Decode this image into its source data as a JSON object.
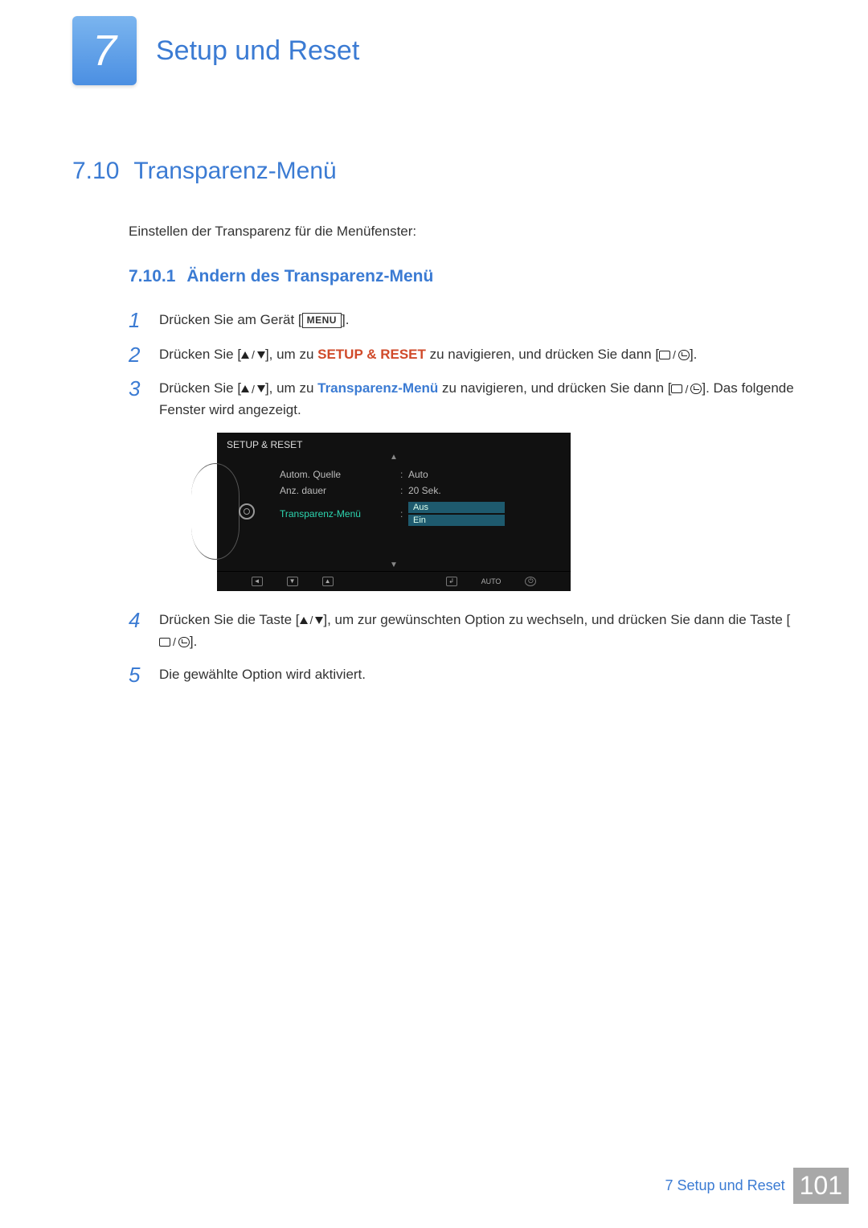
{
  "chapter": {
    "number": "7",
    "title": "Setup und Reset"
  },
  "section": {
    "number": "7.10",
    "title": "Transparenz-Menü"
  },
  "intro": "Einstellen der Transparenz für die Menüfenster:",
  "subsection": {
    "number": "7.10.1",
    "title": "Ändern des Transparenz-Menü"
  },
  "labels": {
    "menu": "MENU",
    "setup_reset": "SETUP & RESET",
    "transparenz": "Transparenz-Menü"
  },
  "steps": {
    "s1": {
      "num": "1",
      "pre": "Drücken Sie am Gerät [",
      "post": "]."
    },
    "s2": {
      "num": "2",
      "a": "Drücken Sie [",
      "b": "], um zu ",
      "c": " zu navigieren, und drücken Sie dann [",
      "d": "]."
    },
    "s3": {
      "num": "3",
      "a": "Drücken Sie [",
      "b": "], um zu ",
      "c": " zu navigieren, und drücken Sie dann [",
      "d": "]. Das folgende Fenster wird angezeigt."
    },
    "s4": {
      "num": "4",
      "a": "Drücken Sie die Taste [",
      "b": "], um zur gewünschten Option zu wechseln, und drücken Sie dann die Taste [",
      "c": "]."
    },
    "s5": {
      "num": "5",
      "text": "Die gewählte Option wird aktiviert."
    }
  },
  "osd": {
    "title": "SETUP & RESET",
    "rows": [
      {
        "label": "Autom. Quelle",
        "value": "Auto"
      },
      {
        "label": "Anz. dauer",
        "value": "20 Sek."
      }
    ],
    "active": {
      "label": "Transparenz-Menü",
      "opt1": "Aus",
      "opt2": "Ein"
    },
    "footer_auto": "AUTO"
  },
  "footer": {
    "chapter_ref": "7 Setup und Reset",
    "page": "101"
  }
}
